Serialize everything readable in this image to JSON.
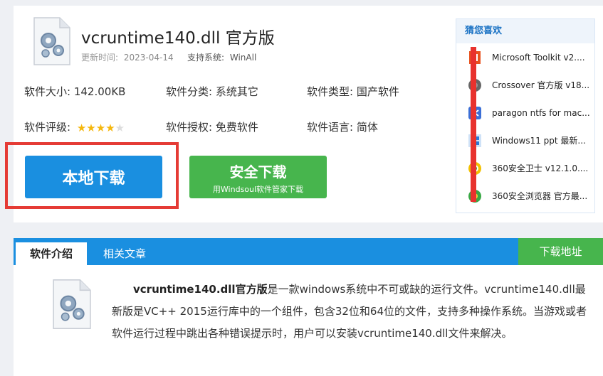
{
  "app": {
    "title": "vcruntime140.dll 官方版",
    "update_label": "更新时间:",
    "update_value": "2023-04-14",
    "system_label": "支持系统:",
    "system_value": "WinAll"
  },
  "info": {
    "size_label": "软件大小:",
    "size_value": "142.00KB",
    "category_label": "软件分类:",
    "category_value": "系统其它",
    "type_label": "软件类型:",
    "type_value": "国产软件",
    "rating_label": "软件评级:",
    "rating_value": 4,
    "rating_max": 5,
    "license_label": "软件授权:",
    "license_value": "免费软件",
    "language_label": "软件语言:",
    "language_value": "简体"
  },
  "buttons": {
    "local_download": "本地下载",
    "safe_download": "安全下载",
    "safe_download_sub": "用Windsoul软件管家下载"
  },
  "sidebar": {
    "title": "猜您喜欢",
    "items": [
      {
        "label": "Microsoft Toolkit v2....",
        "icon": "office-icon"
      },
      {
        "label": "Crossover 官方版 v18...",
        "icon": "crossover-icon"
      },
      {
        "label": "paragon ntfs for mac...",
        "icon": "paragon-icon"
      },
      {
        "label": "Windows11 ppt 最新...",
        "icon": "windows-icon"
      },
      {
        "label": "360安全卫士 v12.1.0....",
        "icon": "360-safe-icon"
      },
      {
        "label": "360安全浏览器 官方最...",
        "icon": "360-browser-icon"
      }
    ]
  },
  "tabs": {
    "intro": "软件介绍",
    "articles": "相关文章",
    "download_address": "下载地址"
  },
  "description": {
    "bold_name": "vcruntime140.dll官方版",
    "text": "是一款windows系统中不可或缺的运行文件。vcruntime140.dll最新版是VC++ 2015运行库中的一个组件，包含32位和64位的文件，支持多种操作系统。当游戏或者软件运行过程中跳出各种错误提示时，用户可以安装vcruntime140.dll文件来解决。"
  },
  "colors": {
    "accent_blue": "#1a8fe0",
    "accent_green": "#47b54d",
    "highlight_red": "#e53b35"
  }
}
